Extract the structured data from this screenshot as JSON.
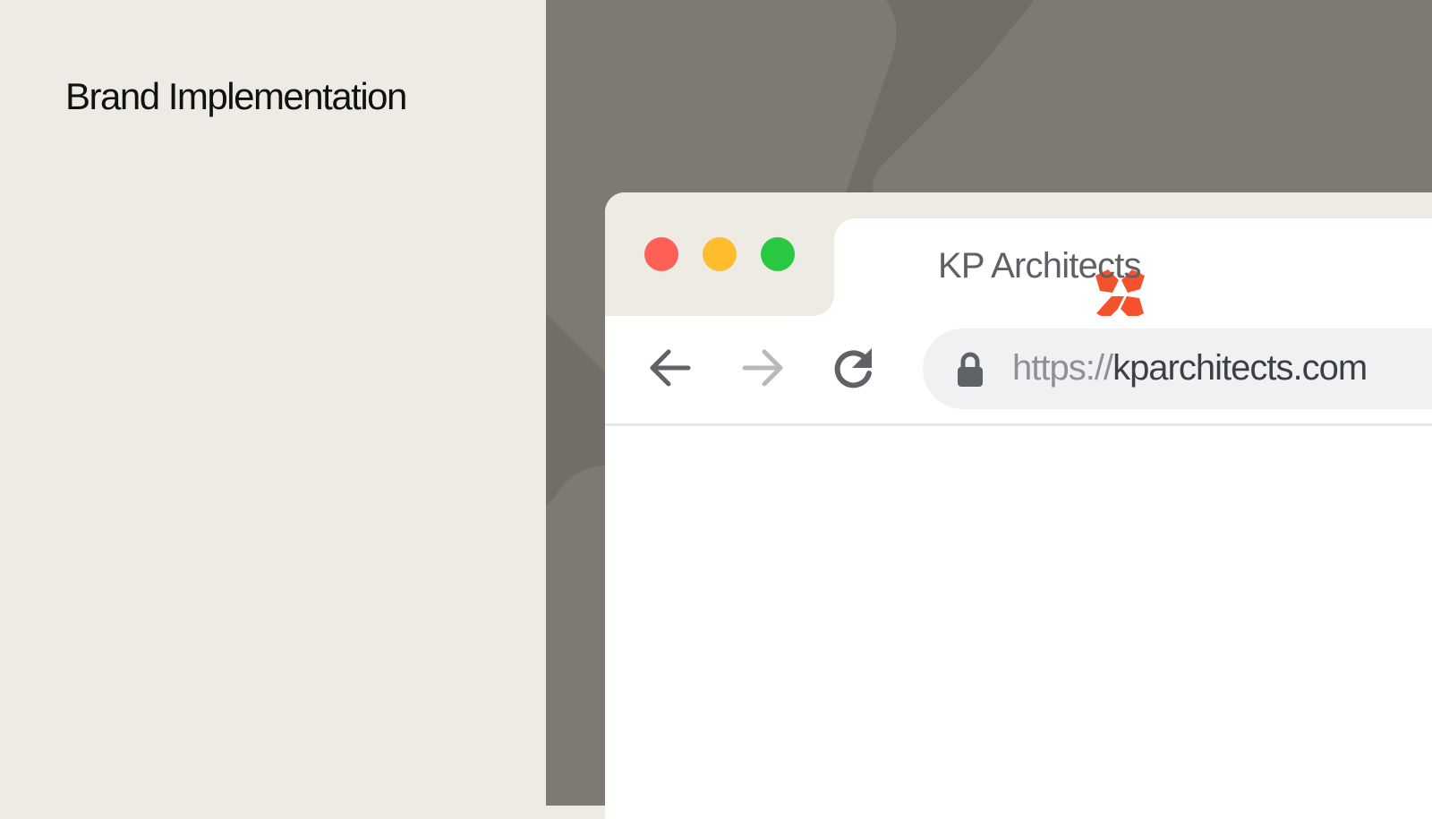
{
  "slide": {
    "title": "Brand Implementation"
  },
  "browser": {
    "traffic_lights": [
      {
        "name": "close",
        "color": "#fe5f57"
      },
      {
        "name": "minimize",
        "color": "#febc2e"
      },
      {
        "name": "maximize",
        "color": "#28c840"
      }
    ],
    "tab": {
      "favicon": "kp-logo-icon",
      "favicon_color": "#f4522d",
      "title": "KP Architects"
    },
    "toolbar": {
      "back_icon": "arrow-left-icon",
      "forward_icon": "arrow-right-icon",
      "reload_icon": "reload-icon",
      "forward_enabled": false
    },
    "address_bar": {
      "lock_icon": "lock-icon",
      "url_scheme": "https://",
      "url_host": "kparchitects.com"
    }
  },
  "colors": {
    "panel_background": "#eeebe5",
    "backdrop": "#7e7a73",
    "backdrop_shape": "#726e67",
    "text_dark": "#111111",
    "icon_gray": "#5f6368",
    "icon_disabled": "#b8b9bc"
  }
}
